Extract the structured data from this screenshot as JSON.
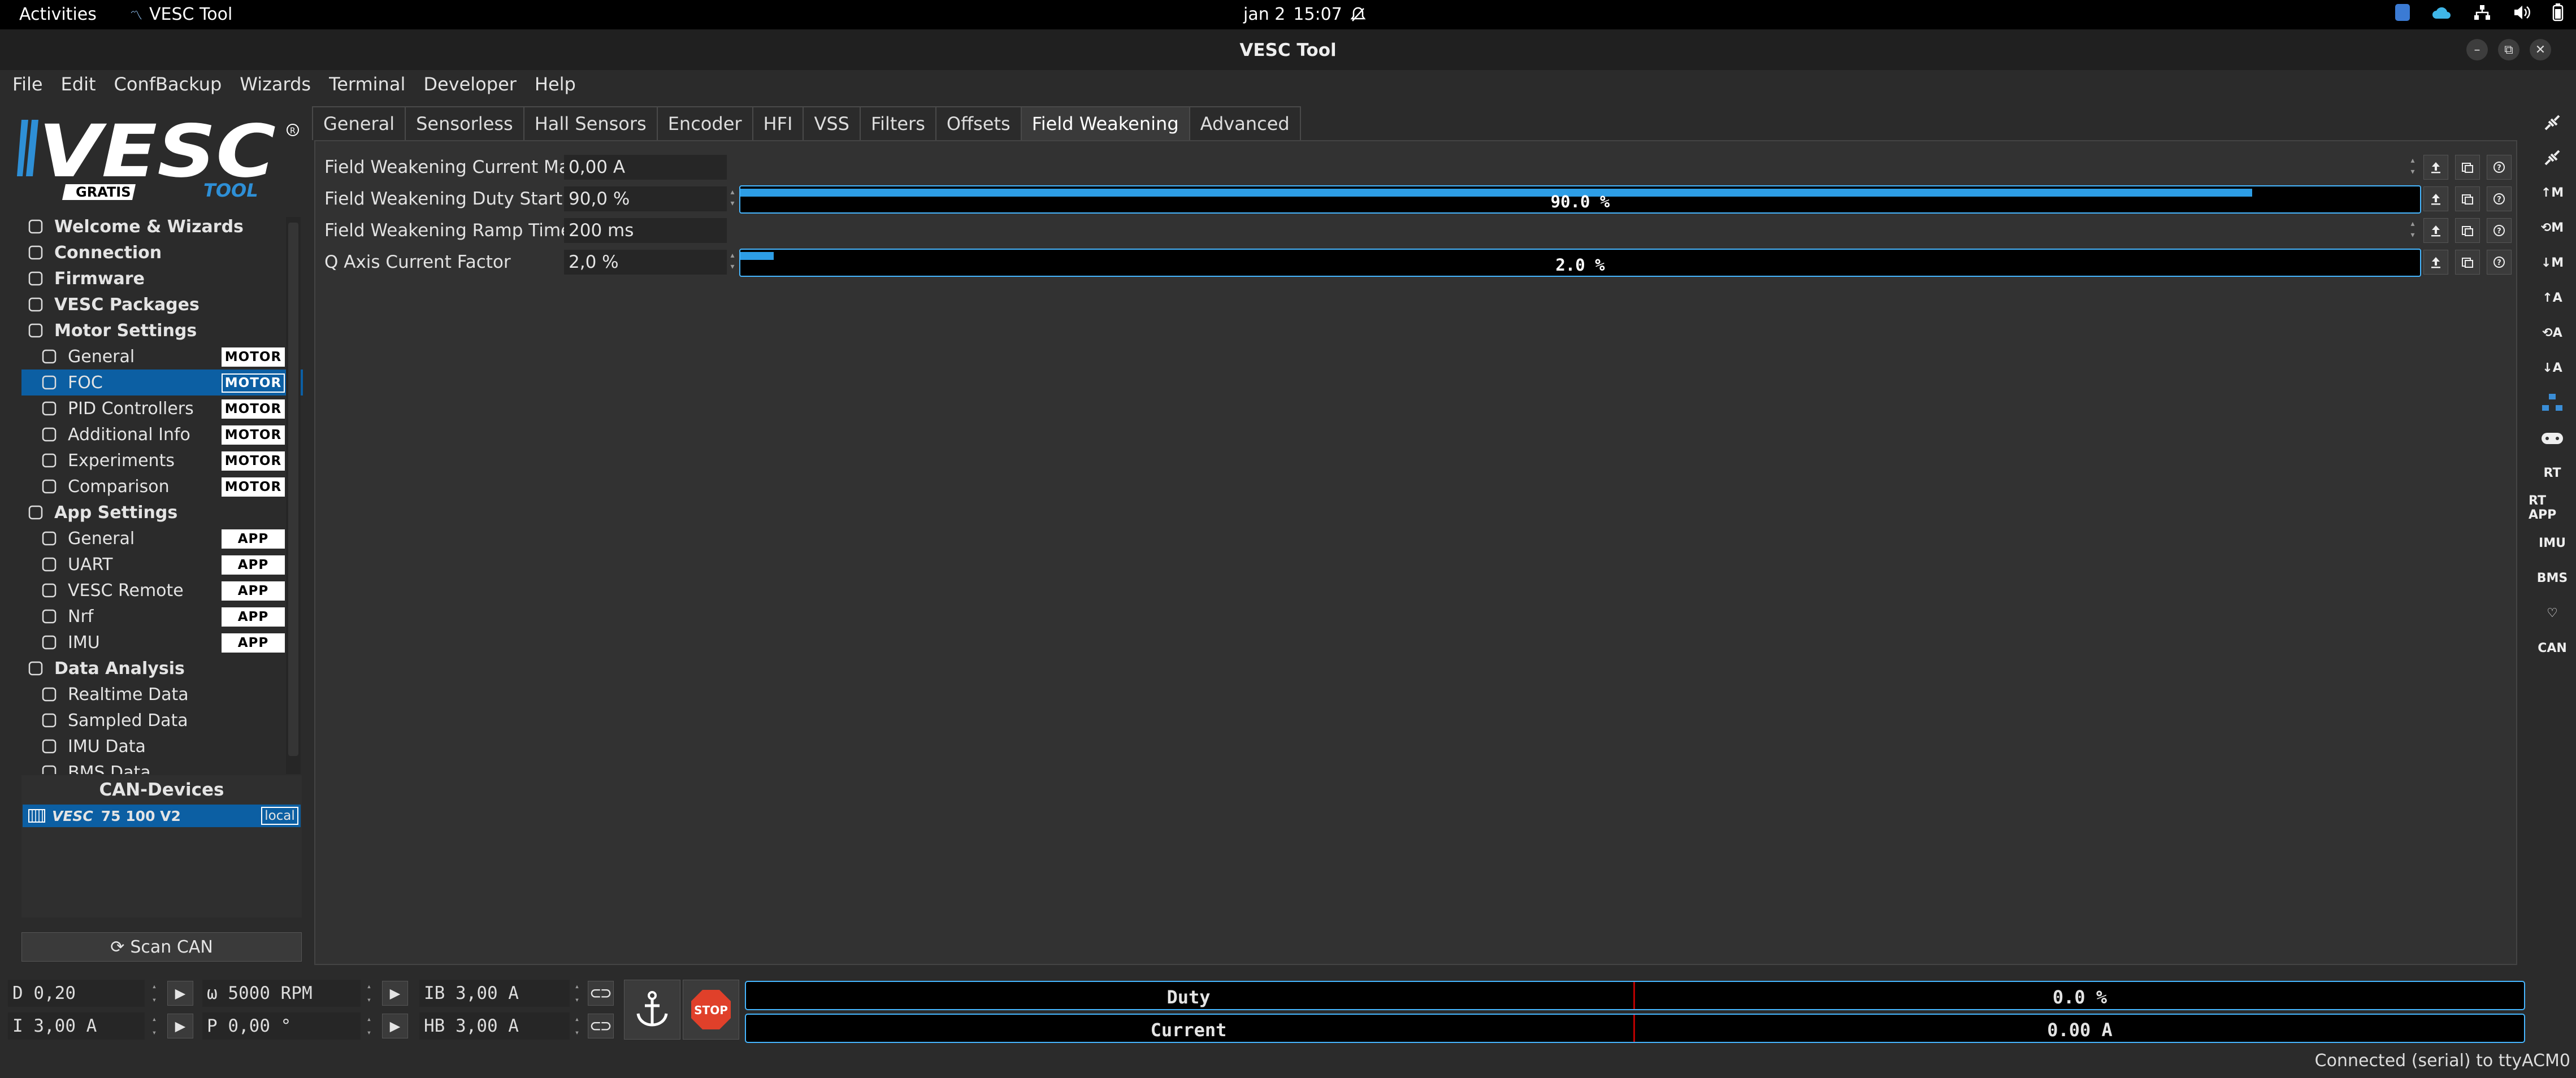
{
  "system_bar": {
    "activities": "Activities",
    "app_name": "VESC Tool",
    "date": "jan 2",
    "time": "15:07"
  },
  "window": {
    "title": "VESC Tool"
  },
  "menu": [
    "File",
    "Edit",
    "ConfBackup",
    "Wizards",
    "Terminal",
    "Developer",
    "Help"
  ],
  "logo": {
    "text": "VESC",
    "sub_left": "GRATIS",
    "sub_right": "TOOL"
  },
  "sidebar": {
    "items": [
      {
        "label": "Welcome & Wizards",
        "level": "top",
        "icon": "home-icon"
      },
      {
        "label": "Connection",
        "level": "top",
        "icon": "connection-icon"
      },
      {
        "label": "Firmware",
        "level": "top",
        "icon": "chip-icon"
      },
      {
        "label": "VESC Packages",
        "level": "top",
        "icon": "package-icon"
      },
      {
        "label": "Motor Settings",
        "level": "top",
        "icon": "motor-icon"
      },
      {
        "label": "General",
        "level": "sub",
        "icon": "sliders-icon",
        "badge": "MOTOR"
      },
      {
        "label": "FOC",
        "level": "sub",
        "icon": "coil-icon",
        "badge": "MOTOR",
        "selected": true
      },
      {
        "label": "PID Controllers",
        "level": "sub",
        "icon": "gauge-icon",
        "badge": "MOTOR"
      },
      {
        "label": "Additional Info",
        "level": "sub",
        "icon": "info-icon",
        "badge": "MOTOR"
      },
      {
        "label": "Experiments",
        "level": "sub",
        "icon": "calculator-icon",
        "badge": "MOTOR"
      },
      {
        "label": "Comparison",
        "level": "sub",
        "icon": "calculator-icon",
        "badge": "MOTOR"
      },
      {
        "label": "App Settings",
        "level": "top",
        "icon": "app-settings-icon"
      },
      {
        "label": "General",
        "level": "sub",
        "icon": "sliders-icon",
        "badge": "APP"
      },
      {
        "label": "UART",
        "level": "sub",
        "icon": "keyboard-icon",
        "badge": "APP"
      },
      {
        "label": "VESC Remote",
        "level": "sub",
        "icon": "remote-icon",
        "badge": "APP"
      },
      {
        "label": "Nrf",
        "level": "sub",
        "icon": "radio-icon",
        "badge": "APP"
      },
      {
        "label": "IMU",
        "level": "sub",
        "icon": "imu-icon",
        "badge": "APP"
      },
      {
        "label": "Data Analysis",
        "level": "top",
        "icon": "chart-icon"
      },
      {
        "label": "Realtime Data",
        "level": "sub",
        "icon": "rt-icon"
      },
      {
        "label": "Sampled Data",
        "level": "sub",
        "icon": "wave-icon"
      },
      {
        "label": "IMU Data",
        "level": "sub",
        "icon": "imu-icon"
      },
      {
        "label": "BMS Data",
        "level": "sub",
        "icon": "bms-icon"
      }
    ]
  },
  "can_devices": {
    "title": "CAN-Devices",
    "device_name": "75 100 V2",
    "device_brand": "VESC",
    "device_tag": "local",
    "scan_label": "Scan CAN"
  },
  "tabs": [
    "General",
    "Sensorless",
    "Hall Sensors",
    "Encoder",
    "HFI",
    "VSS",
    "Filters",
    "Offsets",
    "Field Weakening",
    "Advanced"
  ],
  "active_tab": "Field Weakening",
  "params": [
    {
      "label": "Field Weakening Current Max",
      "value": "0,00 A"
    },
    {
      "label": "Field Weakening Duty Start",
      "value": "90,0 %",
      "bar_text": "90.0 %",
      "bar_fraction": 0.9
    },
    {
      "label": "Field Weakening Ramp Time",
      "value": "200 ms"
    },
    {
      "label": "Q Axis Current Factor",
      "value": "2,0 %",
      "bar_text": "2.0 %",
      "bar_fraction": 0.02
    }
  ],
  "right_toolbar": [
    "↑M",
    "⟲M",
    "↓M",
    "↑A",
    "⟲A",
    "↓A",
    "RT",
    "RT APP",
    "IMU",
    "BMS",
    "♡",
    "CAN"
  ],
  "controls": {
    "duty": "D 0,20",
    "rpm": "ω 5000 RPM",
    "ib": "IB 3,00 A",
    "current": "I 3,00 A",
    "position": "P 0,00 °",
    "hb": "HB 3,00 A",
    "stop": "STOP"
  },
  "gauges": [
    {
      "label": "Duty",
      "value": "0.0 %"
    },
    {
      "label": "Current",
      "value": "0.00 A"
    }
  ],
  "status": "Connected (serial) to ttyACM0",
  "colors": {
    "accent": "#0c5fa3",
    "bar": "#2d9de5",
    "stop": "#e0402a"
  }
}
